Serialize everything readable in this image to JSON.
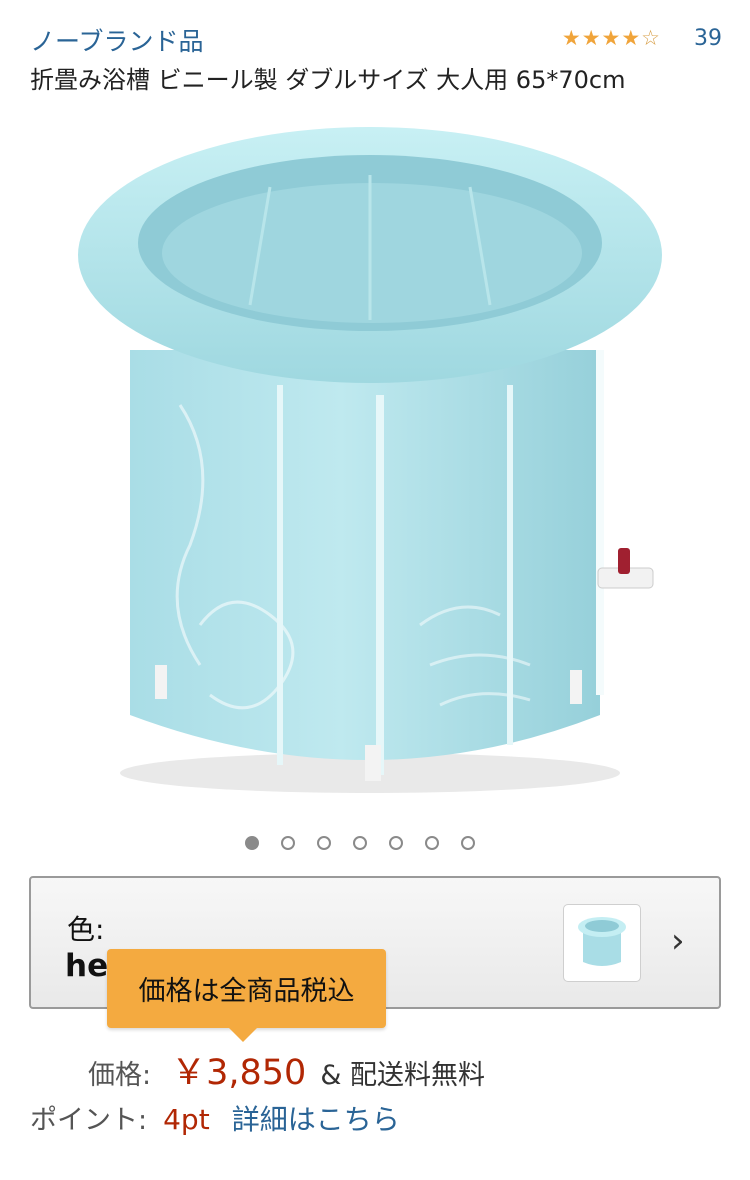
{
  "header": {
    "brand": "ノーブランド品",
    "rating": 4,
    "rating_max": 5,
    "review_count": "39",
    "product_title": "折畳み浴槽 ビニール製 ダブルサイズ 大人用 65*70cm"
  },
  "image_carousel": {
    "total_images": 7,
    "active_index": 0
  },
  "variant": {
    "label": "色:",
    "value": "he"
  },
  "tooltip": {
    "text": "価格は全商品税込"
  },
  "price": {
    "label": "価格:",
    "value": "￥3,850",
    "shipping": "& 配送料無料"
  },
  "points": {
    "label": "ポイント:",
    "value": "4pt",
    "link": "詳細はこちら"
  },
  "colors": {
    "link": "#2a6496",
    "price": "#b12704",
    "star": "#f0a43a",
    "tooltip": "#f4aa40"
  }
}
